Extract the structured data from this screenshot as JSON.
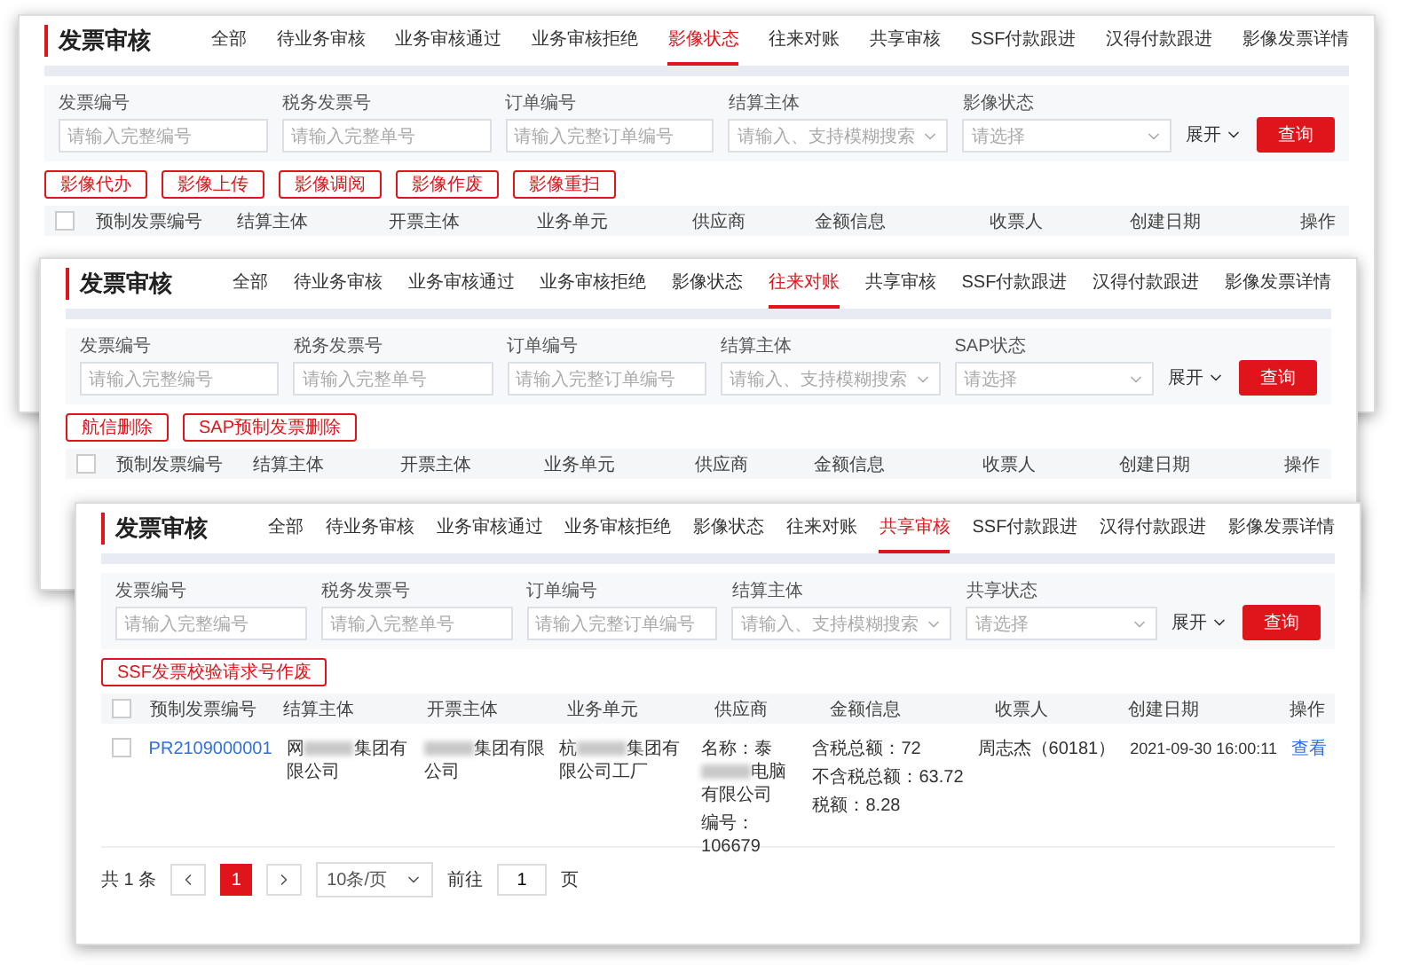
{
  "windows": [
    {
      "title": "发票审核",
      "tabs": [
        {
          "label": "全部",
          "selected": false
        },
        {
          "label": "待业务审核",
          "selected": false
        },
        {
          "label": "业务审核通过",
          "selected": false
        },
        {
          "label": "业务审核拒绝",
          "selected": false
        },
        {
          "label": "影像状态",
          "selected": true
        },
        {
          "label": "往来对账",
          "selected": false
        },
        {
          "label": "共享审核",
          "selected": false
        },
        {
          "label": "SSF付款跟进",
          "selected": false
        },
        {
          "label": "汉得付款跟进",
          "selected": false
        },
        {
          "label": "影像发票详情",
          "selected": false
        }
      ],
      "filters": [
        {
          "label": "发票编号",
          "placeholder": "请输入完整编号",
          "kind": "text"
        },
        {
          "label": "税务发票号",
          "placeholder": "请输入完整单号",
          "kind": "text"
        },
        {
          "label": "订单编号",
          "placeholder": "请输入完整订单编号",
          "kind": "text"
        },
        {
          "label": "结算主体",
          "placeholder": "请输入、支持模糊搜索",
          "kind": "select"
        },
        {
          "label": "影像状态",
          "placeholder": "请选择",
          "kind": "select"
        }
      ],
      "expand": "展开",
      "query": "查询",
      "actions": [
        "影像代办",
        "影像上传",
        "影像调阅",
        "影像作废",
        "影像重扫"
      ],
      "all_checked": false,
      "columns": [
        "预制发票编号",
        "结算主体",
        "开票主体",
        "业务单元",
        "供应商",
        "金额信息",
        "收票人",
        "创建日期",
        "操作"
      ]
    },
    {
      "title": "发票审核",
      "tabs": [
        {
          "label": "全部",
          "selected": false
        },
        {
          "label": "待业务审核",
          "selected": false
        },
        {
          "label": "业务审核通过",
          "selected": false
        },
        {
          "label": "业务审核拒绝",
          "selected": false
        },
        {
          "label": "影像状态",
          "selected": false
        },
        {
          "label": "往来对账",
          "selected": true
        },
        {
          "label": "共享审核",
          "selected": false
        },
        {
          "label": "SSF付款跟进",
          "selected": false
        },
        {
          "label": "汉得付款跟进",
          "selected": false
        },
        {
          "label": "影像发票详情",
          "selected": false
        }
      ],
      "filters": [
        {
          "label": "发票编号",
          "placeholder": "请输入完整编号",
          "kind": "text"
        },
        {
          "label": "税务发票号",
          "placeholder": "请输入完整单号",
          "kind": "text"
        },
        {
          "label": "订单编号",
          "placeholder": "请输入完整订单编号",
          "kind": "text"
        },
        {
          "label": "结算主体",
          "placeholder": "请输入、支持模糊搜索",
          "kind": "select"
        },
        {
          "label": "SAP状态",
          "placeholder": "请选择",
          "kind": "select"
        }
      ],
      "expand": "展开",
      "query": "查询",
      "actions": [
        "航信删除",
        "SAP预制发票删除"
      ],
      "all_checked": false,
      "columns": [
        "预制发票编号",
        "结算主体",
        "开票主体",
        "业务单元",
        "供应商",
        "金额信息",
        "收票人",
        "创建日期",
        "操作"
      ]
    },
    {
      "title": "发票审核",
      "tabs": [
        {
          "label": "全部",
          "selected": false
        },
        {
          "label": "待业务审核",
          "selected": false
        },
        {
          "label": "业务审核通过",
          "selected": false
        },
        {
          "label": "业务审核拒绝",
          "selected": false
        },
        {
          "label": "影像状态",
          "selected": false
        },
        {
          "label": "往来对账",
          "selected": false
        },
        {
          "label": "共享审核",
          "selected": true
        },
        {
          "label": "SSF付款跟进",
          "selected": false
        },
        {
          "label": "汉得付款跟进",
          "selected": false
        },
        {
          "label": "影像发票详情",
          "selected": false
        }
      ],
      "filters": [
        {
          "label": "发票编号",
          "placeholder": "请输入完整编号",
          "kind": "text"
        },
        {
          "label": "税务发票号",
          "placeholder": "请输入完整单号",
          "kind": "text"
        },
        {
          "label": "订单编号",
          "placeholder": "请输入完整订单编号",
          "kind": "text"
        },
        {
          "label": "结算主体",
          "placeholder": "请输入、支持模糊搜索",
          "kind": "select"
        },
        {
          "label": "共享状态",
          "placeholder": "请选择",
          "kind": "select"
        }
      ],
      "expand": "展开",
      "query": "查询",
      "actions": [
        "SSF发票校验请求号作废"
      ],
      "all_checked": false,
      "columns": [
        "预制发票编号",
        "结算主体",
        "开票主体",
        "业务单元",
        "供应商",
        "金额信息",
        "收票人",
        "创建日期",
        "操作"
      ],
      "rows": [
        {
          "checked": false,
          "invoice": "PR2109000001",
          "settlement": [
            {
              "kind": "text",
              "text": "网"
            },
            {
              "kind": "redacted"
            },
            {
              "kind": "text",
              "text": "集团有限公司"
            }
          ],
          "issuer": [
            {
              "kind": "redacted"
            },
            {
              "kind": "text",
              "text": "集团有限公司"
            }
          ],
          "unit": [
            {
              "kind": "text",
              "text": "杭"
            },
            {
              "kind": "redacted"
            },
            {
              "kind": "text",
              "text": "集团有限公司工厂"
            }
          ],
          "supplier": [
            {
              "kind": "text",
              "text": "名称：泰"
            },
            {
              "kind": "redacted"
            },
            {
              "kind": "text",
              "text": "电脑有限公司"
            }
          ],
          "supplier_code": "编号：106679",
          "amounts": [
            "含税总额：72",
            "不含税总额：63.72",
            "税额：8.28"
          ],
          "receiver": "周志杰（60181）",
          "date": "2021-09-30 16:00:11",
          "action": "查看"
        }
      ],
      "pagination": {
        "total": "共 1 条",
        "pages": [
          {
            "label": "1",
            "selected": true
          }
        ],
        "size": "10条/页",
        "goto": "前往",
        "goto_value": "1",
        "unit": "页"
      }
    }
  ]
}
